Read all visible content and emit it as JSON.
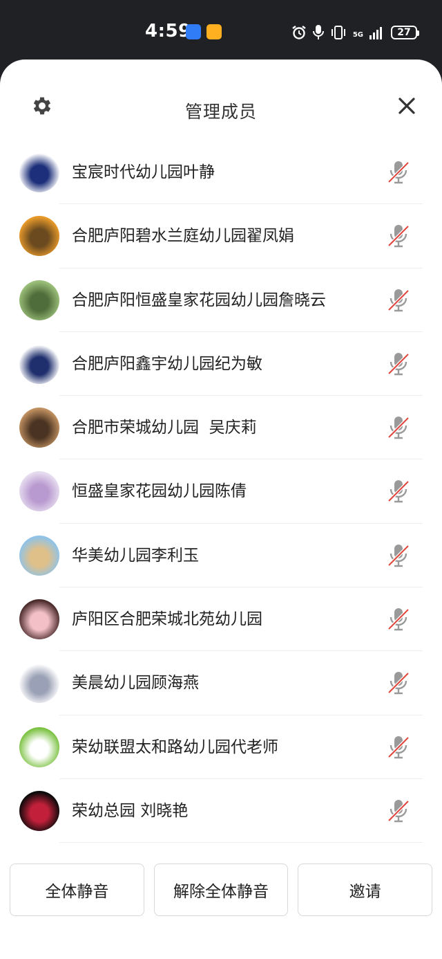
{
  "status_bar": {
    "time": "4:59",
    "network": "5G",
    "battery": "27"
  },
  "sheet": {
    "title": "管理成员"
  },
  "members": [
    {
      "name": "宝宸时代幼儿园叶静",
      "avatar_colors": [
        "#ffffff",
        "#1d2f7a"
      ],
      "mic": "muted"
    },
    {
      "name": "合肥庐阳碧水兰庭幼儿园翟凤娟",
      "avatar_colors": [
        "#e89a2a",
        "#6b4a1f"
      ],
      "mic": "muted"
    },
    {
      "name": "合肥庐阳恒盛皇家花园幼儿园詹晓云",
      "avatar_colors": [
        "#9bbf7a",
        "#4f6d3a"
      ],
      "mic": "muted"
    },
    {
      "name": "合肥庐阳鑫宇幼儿园纪为敏",
      "avatar_colors": [
        "#ffffff",
        "#1f2f6e"
      ],
      "mic": "muted"
    },
    {
      "name": "合肥市荣城幼儿园  吴庆莉",
      "avatar_colors": [
        "#c09060",
        "#4a3322"
      ],
      "mic": "muted"
    },
    {
      "name": "恒盛皇家花园幼儿园陈倩",
      "avatar_colors": [
        "#e6dcef",
        "#b99ad0"
      ],
      "mic": "muted"
    },
    {
      "name": "华美幼儿园李利玉",
      "avatar_colors": [
        "#8fc3e8",
        "#e0c089"
      ],
      "mic": "muted"
    },
    {
      "name": "庐阳区合肥荣城北苑幼儿园",
      "avatar_colors": [
        "#4a2a2a",
        "#f3c0c8"
      ],
      "mic": "muted"
    },
    {
      "name": "美晨幼儿园顾海燕",
      "avatar_colors": [
        "#ffffff",
        "#9aa0b5"
      ],
      "mic": "muted"
    },
    {
      "name": "荣幼联盟太和路幼儿园代老师",
      "avatar_colors": [
        "#7cc243",
        "#ffffff"
      ],
      "mic": "muted"
    },
    {
      "name": "荣幼总园 刘晓艳",
      "avatar_colors": [
        "#0a0a0a",
        "#c2203a"
      ],
      "mic": "muted"
    }
  ],
  "actions": {
    "mute_all": "全体静音",
    "unmute_all": "解除全体静音",
    "invite": "邀请"
  },
  "colors": {
    "mic_gray": "#9a9a9a",
    "mute_slash": "#e0463c"
  }
}
